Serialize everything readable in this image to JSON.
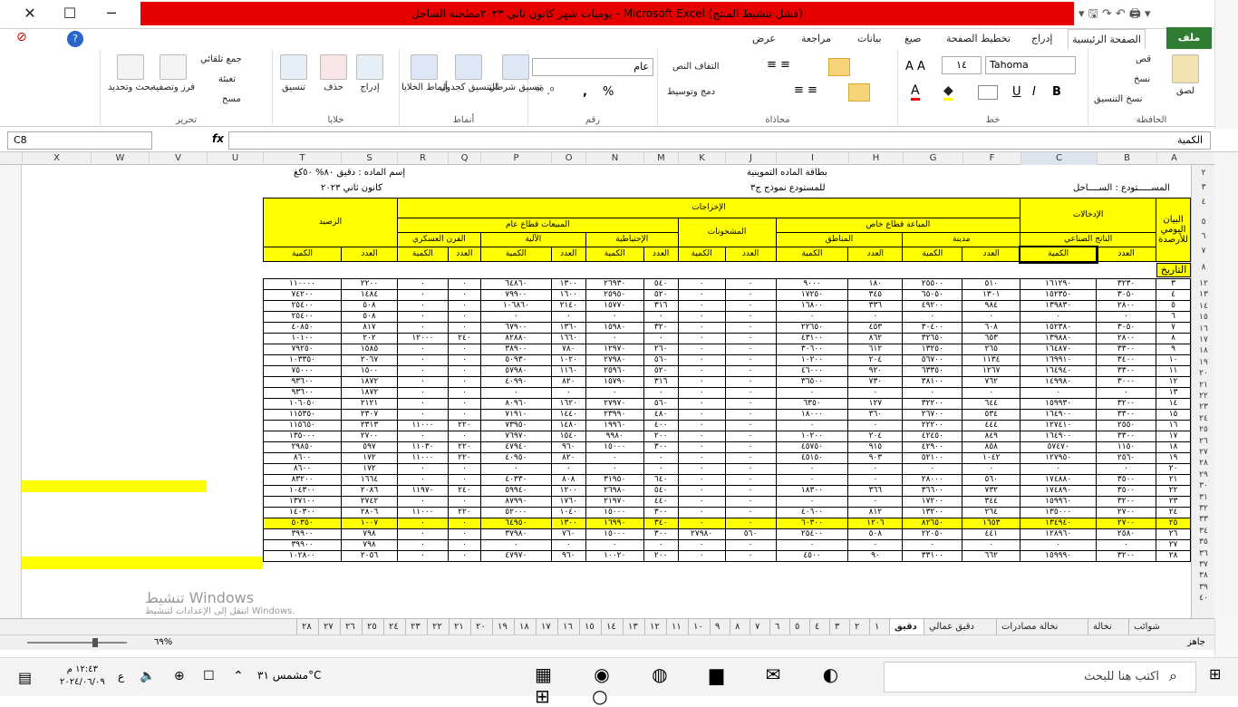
{
  "window": {
    "title": "يوميات شهر كانون ثاني ٢٠٢٣مطحنة الساحل  -  Microsoft Excel  (فشل تنشيط المنتج)",
    "min": "─",
    "max": "☐",
    "close": "✕",
    "help": "?"
  },
  "tabs": [
    "ملف",
    "الصفحة الرئيسية",
    "إدراج",
    "تخطيط الصفحة",
    "صيغ",
    "بيانات",
    "مراجعة",
    "عرض"
  ],
  "ribbon": {
    "clipboard": {
      "label": "الحافظة",
      "paste": "لصق",
      "cut": "قص",
      "copy": "نسخ",
      "format": "نسخ التنسيق"
    },
    "font": {
      "label": "خط",
      "name": "Tahoma",
      "size": "١٤",
      "bold": "B",
      "italic": "I",
      "underline": "U"
    },
    "align": {
      "label": "محاذاة",
      "wrap": "التفاف النص",
      "merge": "دمج وتوسيط"
    },
    "number": {
      "label": "رقم",
      "format": "عام",
      "pct": "%",
      "comma": ","
    },
    "styles": {
      "label": "أنماط",
      "cond": "تنسيق شرطي",
      "table": "التنسيق كجدول",
      "cell": "أنماط الخلايا"
    },
    "cells": {
      "label": "خلايا",
      "insert": "إدراج",
      "delete": "حذف",
      "format": "تنسيق"
    },
    "edit": {
      "label": "تحرير",
      "sum": "جمع تلقائي",
      "fill": "تعبئة",
      "clear": "مسح",
      "sort": "فرز وتصفية",
      "find": "بحث وتحديد"
    }
  },
  "formula": {
    "namebox": "C8",
    "fx": "fx",
    "value": "الكمية"
  },
  "columns": [
    "A",
    "B",
    "C",
    "F",
    "G",
    "H",
    "I",
    "J",
    "K",
    "M",
    "N",
    "O",
    "P",
    "Q",
    "R",
    "S",
    "T",
    "U",
    "V",
    "W",
    "X"
  ],
  "sheet": {
    "card_title": "بطاقة الماده التموينية",
    "card_sub": "للمستودع نموذج ج٣",
    "warehouse": "المســـــتودع : الســــاحل",
    "material": "إسم الماده : دقيق ٨٠% ٥٠كغ",
    "month": "كانون ثاني ٢٠٢٣",
    "h_date": "البيان اليومي للأرصدة",
    "h_in": "الإدخالات",
    "h_out": "الإخراجات",
    "h_bal": "الرصيد",
    "h_factory": "الناتج الصناعي",
    "h_private": "المباعة قطاع خاص",
    "h_city": "مدينة",
    "h_regions": "المناطق",
    "h_shipped": "المشحونات",
    "h_public": "المبيعات قطاع عام",
    "h_reserve": "الإحتياطية",
    "h_auto": "الآلية",
    "h_army": "الفرن العسكري",
    "l_date": "التاريخ",
    "l_count": "العدد",
    "l_qty": "الكمية",
    "rows": [
      [
        "٣",
        "٣٢٣٠",
        "١٦١٢٩٠",
        "٥١٠",
        "٢٥٥٠٠",
        "١٨٠",
        "٩٠٠٠",
        "٠",
        "٠",
        "٥٤٠",
        "٢٦٩٣٠",
        "١٣٠٠",
        "٦٤٨٦٠",
        "٠",
        "٠",
        "٢٢٠٠",
        "١١٠٠٠٠"
      ],
      [
        "٤",
        "٣٠٥٠",
        "١٥٢٣٥٠",
        "١٣٠١",
        "٦٥٠٥٠",
        "٣٤٥",
        "١٧٢٥٠",
        "٠",
        "٠",
        "٥٢٠",
        "٢٥٩٥٠",
        "١٦٠٠",
        "٧٩٩٠٠",
        "٠",
        "٠",
        "١٤٨٤",
        "٧٤٢٠٠"
      ],
      [
        "٥",
        "٢٨٠٠",
        "١٣٩٨٣٠",
        "٩٨٤",
        "٤٩٢٠٠",
        "٣٣٦",
        "١٦٨٠٠",
        "٠",
        "٠",
        "٣١٦",
        "١٥٧٧٠",
        "٢١٤٠",
        "١٠٦٨٦٠",
        "٠",
        "٠",
        "٥٠٨",
        "٢٥٤٠٠"
      ],
      [
        "٦",
        "٠",
        "٠",
        "٠",
        "٠",
        "٠",
        "٠",
        "٠",
        "٠",
        "٠",
        "٠",
        "٠",
        "٠",
        "٠",
        "٠",
        "٥٠٨",
        "٢٥٤٠٠"
      ],
      [
        "٧",
        "٣٠٥٠",
        "١٥٢٣٨٠",
        "٦٠٨",
        "٣٠٤٠٠",
        "٤٥٣",
        "٢٢٦٥٠",
        "٠",
        "٠",
        "٣٢٠",
        "١٥٩٨٠",
        "١٣٦٠",
        "٦٧٩٠٠",
        "٠",
        "٠",
        "٨١٧",
        "٤٠٨٥٠"
      ],
      [
        "٨",
        "٢٨٠٠",
        "١٣٩٨٨٠",
        "٦٥٣",
        "٣٢٦٥٠",
        "٨٦٢",
        "٤٣١٠٠",
        "٠",
        "٠",
        "٠",
        "٠",
        "١٦٦٠",
        "٨٢٨٨٠",
        "٢٤٠",
        "١٢٠٠٠",
        "٢٠٢",
        "١٠١٠٠"
      ],
      [
        "٩",
        "٣٣٠٠",
        "١٦٤٨٧٠",
        "٢٦٥",
        "١٣٢٥٠",
        "٦١٢",
        "٣٠٦٠٠",
        "٠",
        "٠",
        "٢٦٠",
        "١٢٩٧٠",
        "٧٨٠",
        "٣٨٩٠٠",
        "٠",
        "٠",
        "١٥٨٥",
        "٧٩٢٥٠"
      ],
      [
        "١٠",
        "٣٤٠٠",
        "١٦٩٩١٠",
        "١١٣٤",
        "٥٦٧٠٠",
        "٢٠٤",
        "١٠٢٠٠",
        "٠",
        "٠",
        "٥٦٠",
        "٢٧٩٨٠",
        "١٠٢٠",
        "٥٠٩٣٠",
        "٠",
        "٠",
        "٢٠٦٧",
        "١٠٣٣٥٠"
      ],
      [
        "١١",
        "٣٣٠٠",
        "١٦٤٩٤٠",
        "١٢٦٧",
        "٦٣٣٥٠",
        "٩٢٠",
        "٤٦٠٠٠",
        "٠",
        "٠",
        "٥٢٠",
        "٢٥٩٦٠",
        "١١٦٠",
        "٥٧٩٨٠",
        "٠",
        "٠",
        "١٥٠٠",
        "٧٥٠٠٠"
      ],
      [
        "١٢",
        "٣٠٠٠",
        "١٤٩٩٨٠",
        "٧٦٢",
        "٣٨١٠٠",
        "٧٣٠",
        "٣٦٥٠٠",
        "٠",
        "٠",
        "٣١٦",
        "١٥٧٩٠",
        "٨٢٠",
        "٤٠٩٩٠",
        "٠",
        "٠",
        "١٨٧٢",
        "٩٣٦٠٠"
      ],
      [
        "١٣",
        "٠",
        "٠",
        "٠",
        "٠",
        "٠",
        "٠",
        "٠",
        "٠",
        "٠",
        "٠",
        "٠",
        "٠",
        "٠",
        "٠",
        "١٨٧٢",
        "٩٣٦٠٠"
      ],
      [
        "١٤",
        "٣٢٠٠",
        "١٥٩٩٣٠",
        "٦٤٤",
        "٣٢٢٠٠",
        "١٢٧",
        "٦٣٥٠",
        "٠",
        "٠",
        "٥٦٠",
        "٢٧٩٧٠",
        "١٦٢٠",
        "٨٠٩٦٠",
        "٠",
        "٠",
        "٢١٢١",
        "١٠٦٠٥٠"
      ],
      [
        "١٥",
        "٣٣٠٠",
        "١٦٤٩٠٠",
        "٥٣٤",
        "٢٦٧٠٠",
        "٣٦٠",
        "١٨٠٠٠",
        "٠",
        "٠",
        "٤٨٠",
        "٢٣٩٩٠",
        "١٤٤٠",
        "٧١٩١٠",
        "٠",
        "٠",
        "٢٣٠٧",
        "١١٥٣٥٠"
      ],
      [
        "١٦",
        "٢٥٥٠",
        "١٢٧٤١٠",
        "٤٤٤",
        "٢٢٢٠٠",
        "٠",
        "٠",
        "٠",
        "٠",
        "٤٠٠",
        "١٩٩٦٠",
        "١٤٨٠",
        "٧٣٩٥٠",
        "٢٢٠",
        "١١٠٠٠",
        "٢٣١٣",
        "١١٥٦٥٠"
      ],
      [
        "١٧",
        "٣٣٠٠",
        "١٦٤٩٠٠",
        "٨٤٩",
        "٤٢٤٥٠",
        "٢٠٤",
        "١٠٢٠٠",
        "٠",
        "٠",
        "٢٠٠",
        "٩٩٨٠",
        "١٥٤٠",
        "٧٦٩٧٠",
        "٠",
        "٠",
        "٢٧٠٠",
        "١٣٥٠٠٠"
      ],
      [
        "١٨",
        "١١٥٠",
        "٥٧٤٧٠",
        "٨٥٨",
        "٤٢٩٠٠",
        "٩١٥",
        "٤٥٧٥٠",
        "٠",
        "٠",
        "٣٠٠",
        "١٥٠٠٠",
        "٩٦٠",
        "٤٧٩٤٠",
        "٢٢٠",
        "١١٠٣٠",
        "٥٩٧",
        "٢٩٨٥٠"
      ],
      [
        "١٩",
        "٢٥٦٠",
        "١٢٧٩٥٠",
        "١٠٤٢",
        "٥٢١٠٠",
        "٩٠٣",
        "٤٥١٥٠",
        "٠",
        "٠",
        "٠",
        "٠",
        "٨٢٠",
        "٤٠٩٥٠",
        "٢٢٠",
        "١١٠٠٠",
        "١٧٢",
        "٨٦٠٠"
      ],
      [
        "٢٠",
        "٠",
        "٠",
        "٠",
        "٠",
        "٠",
        "٠",
        "٠",
        "٠",
        "٠",
        "٠",
        "٠",
        "٠",
        "٠",
        "٠",
        "١٧٢",
        "٨٦٠٠"
      ],
      [
        "٢١",
        "٣٥٠٠",
        "١٧٤٨٨٠",
        "٥٦٠",
        "٢٨٠٠٠",
        "٠",
        "٠",
        "٠",
        "٠",
        "٦٤٠",
        "٣١٩٥٠",
        "٨٠٨",
        "٤٠٣٣٠",
        "٠",
        "٠",
        "١٦٦٤",
        "٨٣٢٠٠"
      ],
      [
        "٢٢",
        "٣٥٠٠",
        "١٧٤٨٩٠",
        "٧٣٢",
        "٣٦٦٠٠",
        "٣٦٦",
        "١٨٣٠٠",
        "٠",
        "٠",
        "٥٤٠",
        "٢٦٩٨٠",
        "١٢٠٠",
        "٥٩٩٤٠",
        "٢٤٠",
        "١١٩٧٠",
        "٢٠٨٦",
        "١٠٤٣٠٠"
      ],
      [
        "٢٣",
        "٣٢٠٠",
        "١٥٩٩٦٠",
        "٣٤٤",
        "١٧٢٠٠",
        "٠",
        "٠",
        "٠",
        "٠",
        "٤٤٠",
        "٢١٩٧٠",
        "١٧٦٠",
        "٨٧٩٩٠",
        "٠",
        "٠",
        "٢٧٤٢",
        "١٣٧١٠٠"
      ],
      [
        "٢٤",
        "٢٧٠٠",
        "١٣٥٠٠٠",
        "٢٦٤",
        "١٣٢٠٠",
        "٨١٢",
        "٤٠٦٠٠",
        "٠",
        "٠",
        "٣٠٠",
        "١٥٠٠٠",
        "١٠٤٠",
        "٥٢٠٠٠",
        "٢٢٠",
        "١١٠٠٠",
        "٢٨٠٦",
        "١٤٠٣٠٠"
      ],
      [
        "٢٥",
        "٢٧٠٠",
        "١٣٤٩٤٠",
        "١٦٥٣",
        "٨٢٦٥٠",
        "١٢٠٦",
        "٦٠٣٠٠",
        "٠",
        "٠",
        "٣٤٠",
        "١٦٩٩٠",
        "١٣٠٠",
        "٦٤٩٥٠",
        "٠",
        "٠",
        "١٠٠٧",
        "٥٠٣٥٠"
      ],
      [
        "٢٦",
        "٢٥٨٠",
        "١٢٨٩٦٠",
        "٤٤١",
        "٢٢٠٥٠",
        "٥٠٨",
        "٢٥٤٠٠",
        "٥٦٠",
        "٢٧٩٨٠",
        "٣٠٠",
        "١٥٠٠٠",
        "٧٦٠",
        "٣٧٩٨٠",
        "٠",
        "٠",
        "٧٩٨",
        "٣٩٩٠٠"
      ],
      [
        "٢٧",
        "٠",
        "٠",
        "٠",
        "٠",
        "٠",
        "٠",
        "٠",
        "٠",
        "٠",
        "٠",
        "٠",
        "٠",
        "٠",
        "٠",
        "٧٩٨",
        "٣٩٩٠٠"
      ],
      [
        "٢٨",
        "٣٢٠٠",
        "١٥٩٩٩٠",
        "٦٦٢",
        "٣٣١٠٠",
        "٩٠",
        "٤٥٠٠",
        "٠",
        "٠",
        "٢٠٠",
        "١٠٠٢٠",
        "٩٦٠",
        "٤٧٩٧٠",
        "٠",
        "٠",
        "٢٠٥٦",
        "١٠٢٨٠٠"
      ]
    ],
    "highlight_row": 22
  },
  "sheettabs": [
    "شوائب",
    "نخالة",
    "نخالة مصادرات",
    "دقيق عمالي",
    "دقيق",
    "١",
    "٢",
    "٣",
    "٤",
    "٥",
    "٦",
    "٧",
    "٨",
    "٩",
    "١٠",
    "١١",
    "١٢",
    "١٣",
    "١٤",
    "١٥",
    "١٦",
    "١٧",
    "١٨",
    "١٩",
    "٢٠",
    "٢١",
    "٢٢",
    "٢٣",
    "٢٤",
    "٢٥",
    "٢٦",
    "٢٧",
    "٢٨"
  ],
  "status": {
    "ready": "جاهز",
    "zoom": "٦٩%"
  },
  "watermark": {
    "line1": "تنشيط Windows",
    "line2": "انتقل إلى الإعدادات لتنشيط Windows."
  },
  "taskbar": {
    "search": "اكتب هنا للبحث",
    "time": "١٢:٤٣ م",
    "date": "٢٠٢٤/٠٦/٠٩",
    "weather": "مشمس ٣١°C",
    "lang": "ع"
  }
}
